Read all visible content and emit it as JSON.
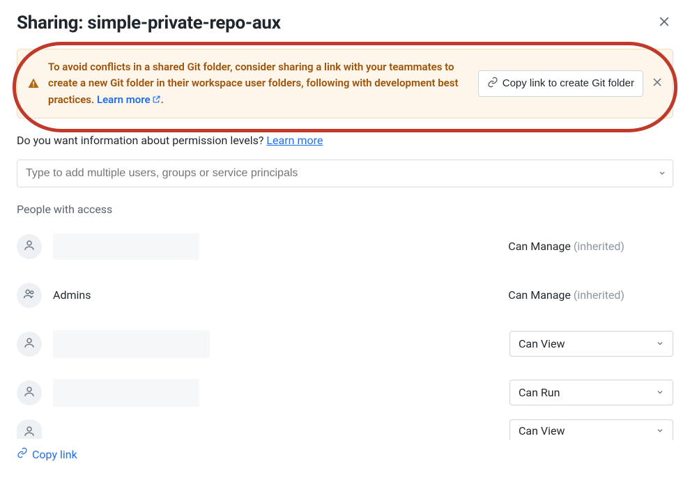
{
  "dialog": {
    "title": "Sharing: simple-private-repo-aux"
  },
  "banner": {
    "text_before_link": "To avoid conflicts in a shared Git folder, consider sharing a link with your teammates to create a new Git folder in their workspace user folders, following with development best practices. ",
    "learn_more_label": "Learn more",
    "period": ".",
    "button_label": "Copy link to create Git folder"
  },
  "info": {
    "question": "Do you want information about permission levels? ",
    "link_label": "Learn more"
  },
  "add_input": {
    "placeholder": "Type to add multiple users, groups or service principals"
  },
  "section": {
    "people_with_access": "People with access"
  },
  "rows": [
    {
      "type": "user-redacted",
      "perm_label": "Can Manage",
      "perm_suffix": " (inherited)",
      "perm_kind": "text"
    },
    {
      "type": "group",
      "name": "Admins",
      "perm_label": "Can Manage",
      "perm_suffix": " (inherited)",
      "perm_kind": "text"
    },
    {
      "type": "user-redacted",
      "perm_label": "Can View",
      "perm_kind": "select"
    },
    {
      "type": "user-redacted",
      "perm_label": "Can Run",
      "perm_kind": "select"
    },
    {
      "type": "user-redacted-cut",
      "perm_label": "Can View",
      "perm_kind": "select-cut"
    }
  ],
  "footer": {
    "copy_link_label": "Copy link"
  }
}
